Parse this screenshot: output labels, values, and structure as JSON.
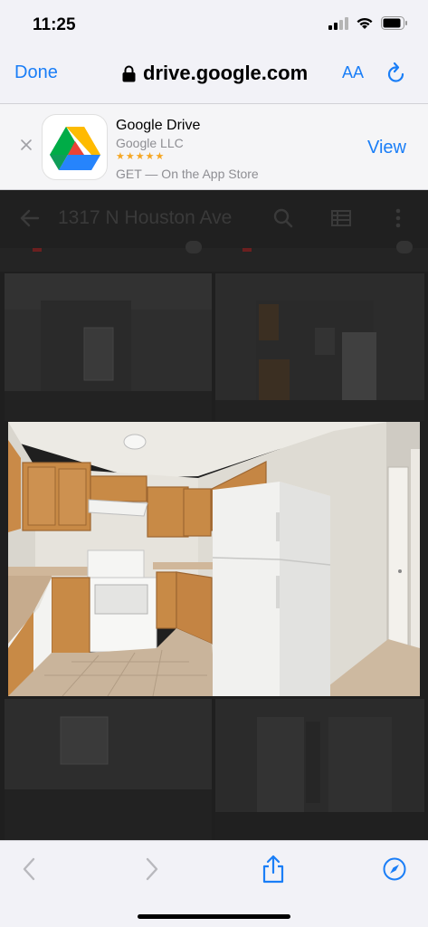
{
  "status": {
    "time": "11:25"
  },
  "nav": {
    "done_label": "Done",
    "url": "drive.google.com",
    "aa_label": "AA"
  },
  "banner": {
    "app_name": "Google Drive",
    "developer": "Google LLC",
    "stars": "★★★★★",
    "get_text": "GET — On the App Store",
    "view_label": "View"
  },
  "viewer": {
    "folder_title": "1317 N Houston Ave"
  },
  "colors": {
    "accent": "#1a7ef7",
    "viewer_bg": "#1f1f1f"
  }
}
